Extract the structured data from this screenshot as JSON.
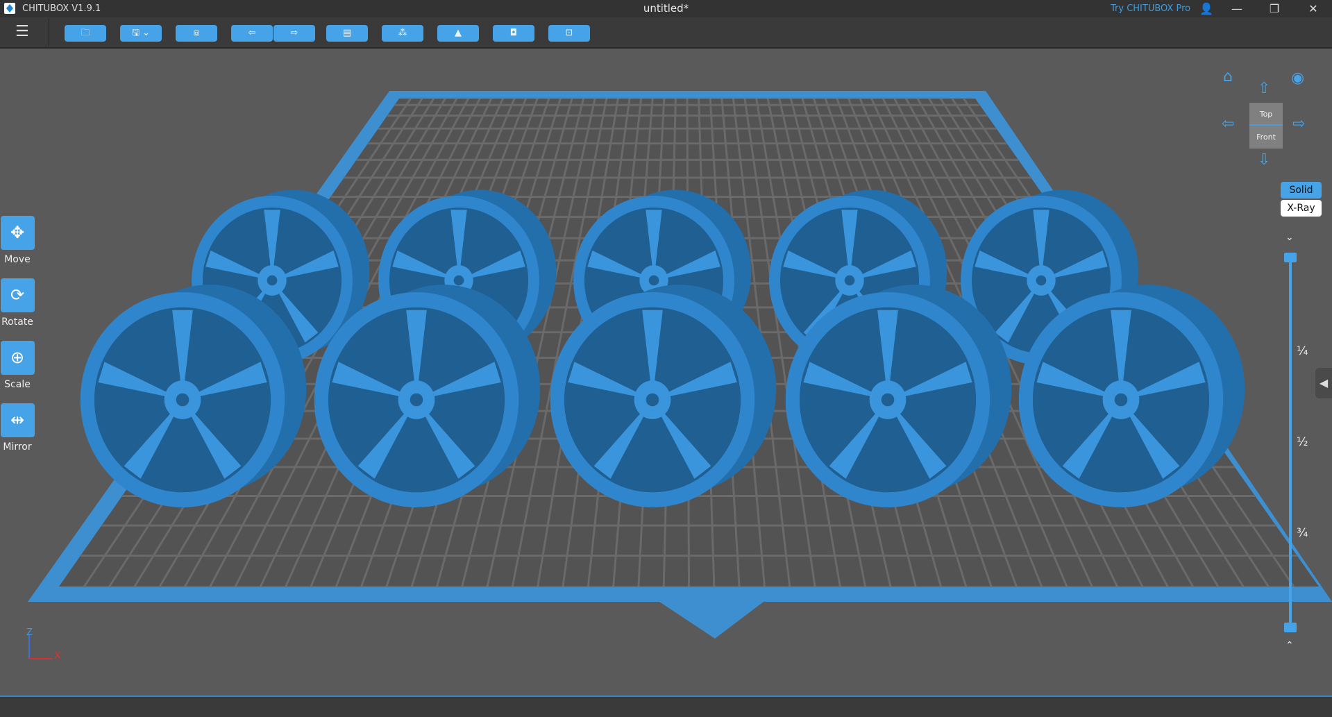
{
  "titlebar": {
    "app_name": "CHITUBOX V1.9.1",
    "document_title": "untitled*",
    "try_pro": "Try CHITUBOX Pro",
    "minimize": "—",
    "restore": "❐",
    "close": "✕"
  },
  "toolbar": {
    "buttons": [
      {
        "icon": "open-file-icon",
        "glyph": "🗀"
      },
      {
        "icon": "save-icon",
        "glyph": "🖫 ⌄"
      },
      {
        "icon": "center-model-icon",
        "glyph": "⧈"
      },
      {
        "icon": "undo-icon",
        "glyph": "⇦"
      },
      {
        "icon": "redo-icon",
        "glyph": "⇨"
      },
      {
        "icon": "settings-icon",
        "glyph": "▤"
      },
      {
        "icon": "arrange-icon",
        "glyph": "⁂"
      },
      {
        "icon": "supports-icon",
        "glyph": "▲"
      },
      {
        "icon": "hollow-icon",
        "glyph": "◘"
      },
      {
        "icon": "slice-icon",
        "glyph": "⊡"
      }
    ]
  },
  "tools": [
    {
      "label": "Move",
      "glyph": "✥"
    },
    {
      "label": "Rotate",
      "glyph": "⟳"
    },
    {
      "label": "Scale",
      "glyph": "⊕"
    },
    {
      "label": "Mirror",
      "glyph": "⇹"
    }
  ],
  "view": {
    "top": "Top",
    "front": "Front",
    "solid": "Solid",
    "xray": "X-Ray"
  },
  "slider": {
    "quarter": "¼",
    "half": "½",
    "three_quarter": "¾",
    "top_value": 1,
    "bottom_value": 0
  },
  "axis": {
    "z": "Z",
    "x": "X"
  },
  "colors": {
    "accent": "#46a3e8",
    "model": "#2f86cc",
    "plate": "#3e8fd0"
  }
}
